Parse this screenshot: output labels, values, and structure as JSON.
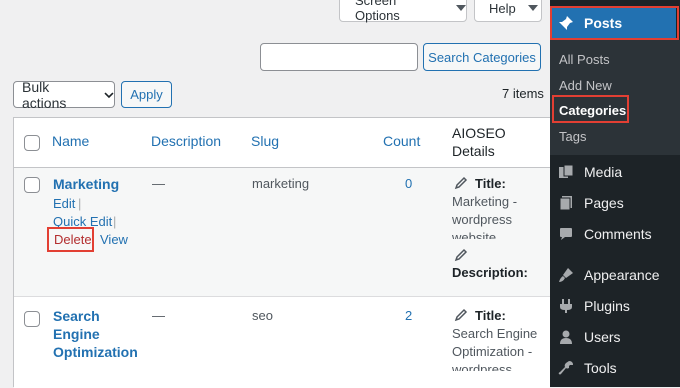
{
  "header": {
    "screen_options_label": "Screen Options",
    "help_label": "Help"
  },
  "search": {
    "button_label": "Search Categories",
    "input_value": ""
  },
  "bulk": {
    "select_label": "Bulk actions",
    "apply_label": "Apply",
    "items_count": "7 items"
  },
  "table": {
    "columns": {
      "name": "Name",
      "description": "Description",
      "slug": "Slug",
      "count": "Count",
      "aioseo_line1": "AIOSEO",
      "aioseo_line2": "Details"
    },
    "rows": [
      {
        "name": "Marketing",
        "description": "—",
        "slug": "marketing",
        "count": "0",
        "actions": {
          "edit": "Edit",
          "quick_edit": "Quick Edit",
          "delete": "Delete",
          "view": "View",
          "sep": "|"
        },
        "seo_title_label": "Title:",
        "seo_title_lines": [
          "Marketing -",
          "wordpress",
          "website"
        ],
        "seo_desc_label": "Description:"
      },
      {
        "name_lines": [
          "Search",
          "Engine",
          "Optimization"
        ],
        "description": "—",
        "slug": "seo",
        "count": "2",
        "seo_title_label": "Title:",
        "seo_title_lines": [
          "Search Engine",
          "Optimization -",
          "wordpress"
        ]
      }
    ]
  },
  "sidebar": {
    "posts_label": "Posts",
    "submenu": [
      "All Posts",
      "Add New",
      "Categories",
      "Tags"
    ],
    "items": [
      {
        "label": "Media",
        "icon": "media-icon"
      },
      {
        "label": "Pages",
        "icon": "pages-icon"
      },
      {
        "label": "Comments",
        "icon": "comments-icon"
      },
      {
        "label": "Appearance",
        "icon": "appearance-icon"
      },
      {
        "label": "Plugins",
        "icon": "plugins-icon"
      },
      {
        "label": "Users",
        "icon": "users-icon"
      },
      {
        "label": "Tools",
        "icon": "tools-icon"
      }
    ]
  },
  "colors": {
    "accent": "#2271b1",
    "sidebar_bg": "#1d2327",
    "highlight_red": "#e23f33"
  }
}
